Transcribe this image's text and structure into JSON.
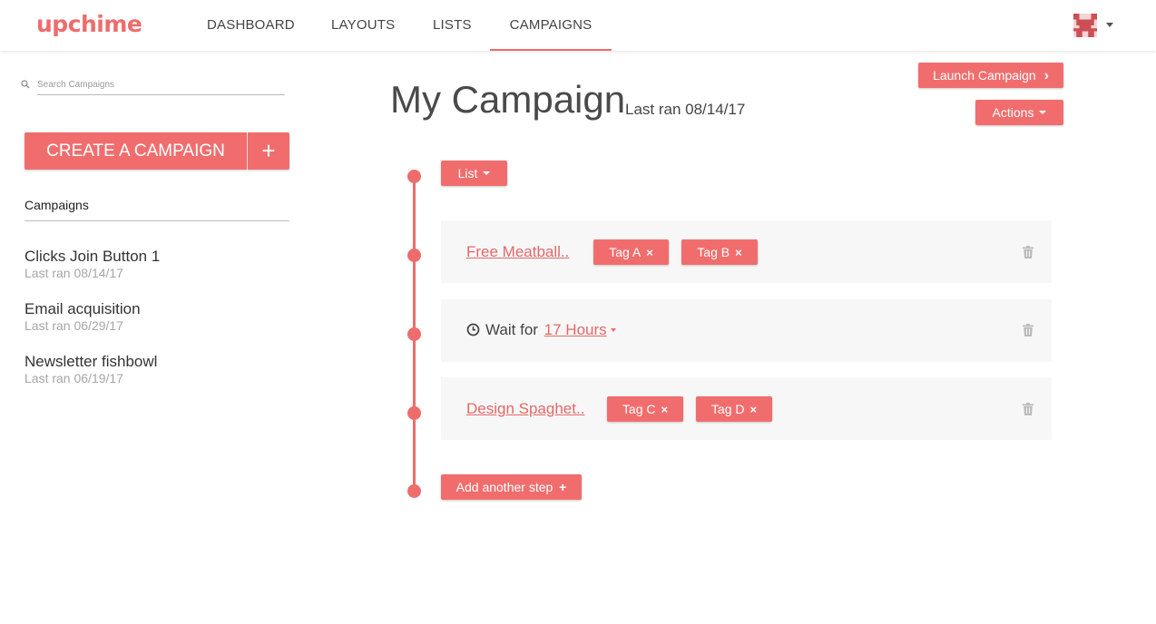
{
  "header": {
    "logo": "upchime",
    "nav": [
      {
        "label": "DASHBOARD"
      },
      {
        "label": "LAYOUTS"
      },
      {
        "label": "LISTS"
      },
      {
        "label": "CAMPAIGNS"
      }
    ],
    "active_tab": "CAMPAIGNS"
  },
  "sidebar": {
    "search_placeholder": "Search Campaigns",
    "create_label": "CREATE A CAMPAIGN",
    "create_plus": "+",
    "section_title": "Campaigns",
    "campaigns": [
      {
        "name": "Clicks Join Button 1",
        "last_ran": "Last ran 08/14/17"
      },
      {
        "name": "Email acquisition",
        "last_ran": "Last ran 06/29/17"
      },
      {
        "name": "Newsletter fishbowl",
        "last_ran": "Last ran 06/19/17"
      }
    ]
  },
  "main": {
    "title": "My Campaign",
    "subtitle": "Last ran 08/14/17",
    "launch_label": "Launch Campaign",
    "actions_label": "Actions",
    "list_label": "List",
    "steps": [
      {
        "link": "Free Meatball..",
        "tags": [
          "Tag A",
          "Tag B"
        ]
      },
      {
        "wait_prefix": "Wait for",
        "wait_value": "17 Hours"
      },
      {
        "link": "Design Spaghet..",
        "tags": [
          "Tag C",
          "Tag D"
        ]
      }
    ],
    "add_step_label": "Add another step",
    "tag_remove": "×",
    "chevron": "›",
    "plus": "+"
  },
  "colors": {
    "accent": "#f16d6d",
    "link": "#e36868",
    "card_bg": "#f7f7f7",
    "muted": "#a6a6a6"
  }
}
